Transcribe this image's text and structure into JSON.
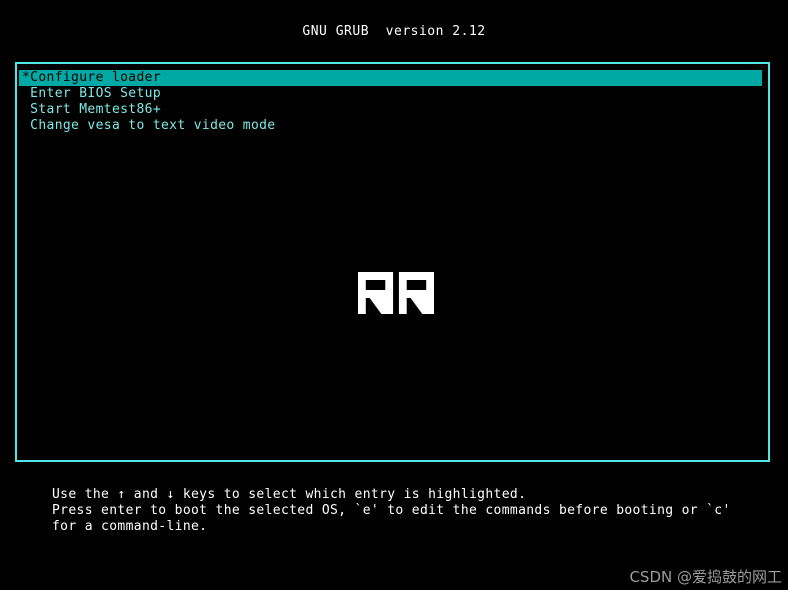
{
  "title": "GNU GRUB  version 2.12",
  "menu": {
    "items": [
      {
        "label": "*Configure loader",
        "selected": true
      },
      {
        "label": " Enter BIOS Setup",
        "selected": false
      },
      {
        "label": " Start Memtest86+",
        "selected": false
      },
      {
        "label": " Change vesa to text video mode",
        "selected": false
      }
    ]
  },
  "logo": {
    "text": "RR"
  },
  "help": {
    "lines": [
      "Use the ↑ and ↓ keys to select which entry is highlighted.",
      "Press enter to boot the selected OS, `e' to edit the commands before booting or `c'",
      "for a command-line."
    ]
  },
  "watermark": "CSDN @爱捣鼓的网工",
  "colors": {
    "background": "#000000",
    "box_border": "#4fe6e6",
    "menu_text": "#7ee8e4",
    "highlight_bg": "#00a9a4",
    "highlight_text": "#000000",
    "title_text": "#ffffff",
    "help_text": "#ffffff",
    "logo": "#ffffff",
    "watermark": "#9b9b9b"
  }
}
